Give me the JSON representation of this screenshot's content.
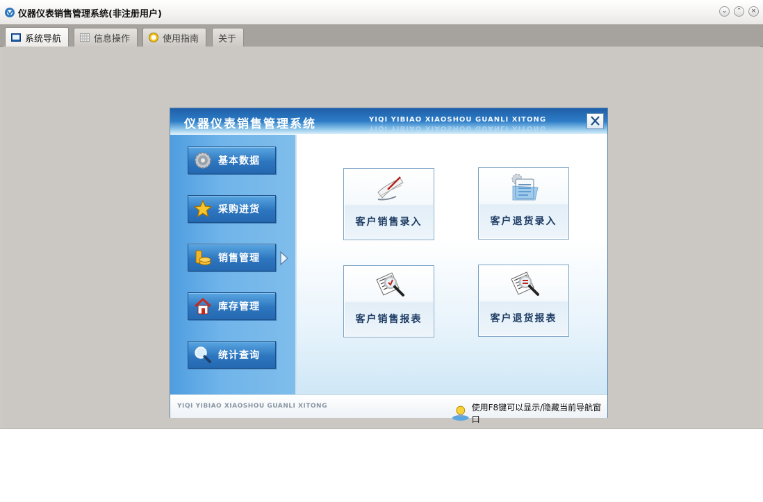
{
  "window": {
    "title": "仪器仪表销售管理系统(非注册用户)",
    "buttons": [
      "⌄",
      "⌃",
      "×"
    ]
  },
  "tabs": [
    {
      "label": "系统导航",
      "icon": "monitor-icon",
      "active": true
    },
    {
      "label": "信息操作",
      "icon": "grid-icon",
      "active": false
    },
    {
      "label": "使用指南",
      "icon": "help-icon",
      "active": false
    },
    {
      "label": "关于",
      "icon": "",
      "active": false
    }
  ],
  "dialog": {
    "title": "仪器仪表销售管理系统",
    "pinyin": "YIQI YIBIAO XIAOSHOU GUANLI XITONG",
    "sidebar": [
      {
        "label": "基本数据",
        "icon": "gear-icon"
      },
      {
        "label": "采购进货",
        "icon": "star-icon"
      },
      {
        "label": "销售管理",
        "icon": "coins-icon"
      },
      {
        "label": "库存管理",
        "icon": "house-icon"
      },
      {
        "label": "统计查询",
        "icon": "magnifier-icon"
      }
    ],
    "cards": [
      {
        "label": "客户销售录入",
        "icon": "document-pen-icon"
      },
      {
        "label": "客户退货录入",
        "icon": "folder-settings-icon"
      },
      {
        "label": "客户销售报表",
        "icon": "report-search-icon"
      },
      {
        "label": "客户退货报表",
        "icon": "report-search-icon"
      }
    ],
    "footer": {
      "pinyin": "YIQI YIBIAO XIAOSHOU GUANLI XITONG",
      "hint": "使用F8键可以显示/隐藏当前导航窗口"
    }
  },
  "colors": {
    "accent": "#2d76bf",
    "header_dark": "#1f5fa7",
    "card_text": "#1d3b63"
  }
}
